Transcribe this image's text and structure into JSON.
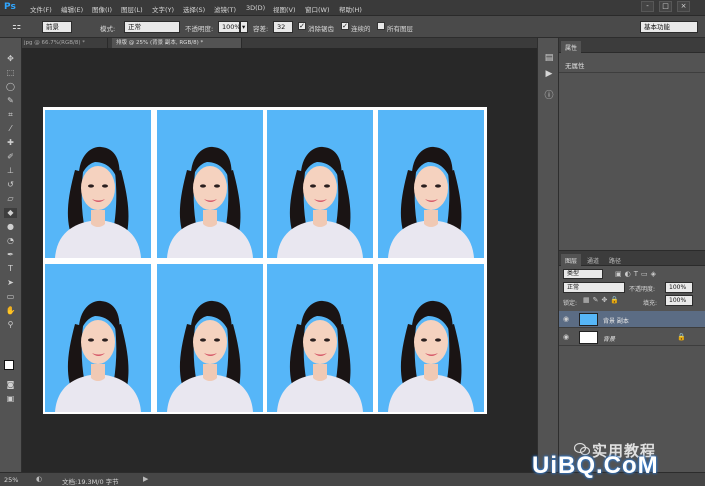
{
  "app": {
    "logo": "Ps"
  },
  "menu": [
    "文件(F)",
    "编辑(E)",
    "图像(I)",
    "图层(L)",
    "文字(Y)",
    "选择(S)",
    "滤镜(T)",
    "3D(D)",
    "视图(V)",
    "窗口(W)",
    "帮助(H)"
  ],
  "window_controls": [
    "-",
    "□",
    "×"
  ],
  "options": {
    "fill_select": "前景",
    "mode_label": "模式:",
    "mode_value": "正常",
    "opacity_label": "不透明度:",
    "opacity_value": "100%",
    "tolerance_label": "容差:",
    "tolerance_value": "32",
    "antialias_label": "消除锯齿",
    "contiguous_label": "连续的",
    "all_layers_label": "所有图层",
    "workspace": "基本功能"
  },
  "tabs": [
    {
      "label": "jpg @ 66.7%(RGB/8) *",
      "active": false
    },
    {
      "label": "排版 @ 25% (背景 副本, RGB/8) *",
      "active": true
    }
  ],
  "properties_panel": {
    "title": "属性",
    "content": "无属性"
  },
  "layers_panel": {
    "tabs": [
      "图层",
      "通道",
      "路径"
    ],
    "kind_filter": "类型",
    "blend_mode": "正常",
    "opacity_label": "不透明度:",
    "opacity_value": "100%",
    "lock_label": "锁定:",
    "fill_label": "填充:",
    "fill_value": "100%",
    "layers": [
      {
        "name": "背景 副本",
        "selected": true
      },
      {
        "name": "背景",
        "selected": false
      }
    ]
  },
  "status": {
    "zoom": "25%",
    "doc_info": "文档:19.3M/0 字节"
  },
  "watermark": {
    "cn_text": "实用教程",
    "site": "UiBQ.CoM"
  },
  "photos_grid": {
    "rows": 2,
    "cols": 4,
    "background_color": "#56b6f8"
  },
  "colors": {
    "accent": "#30a6ff",
    "selection": "#5b6c84"
  }
}
